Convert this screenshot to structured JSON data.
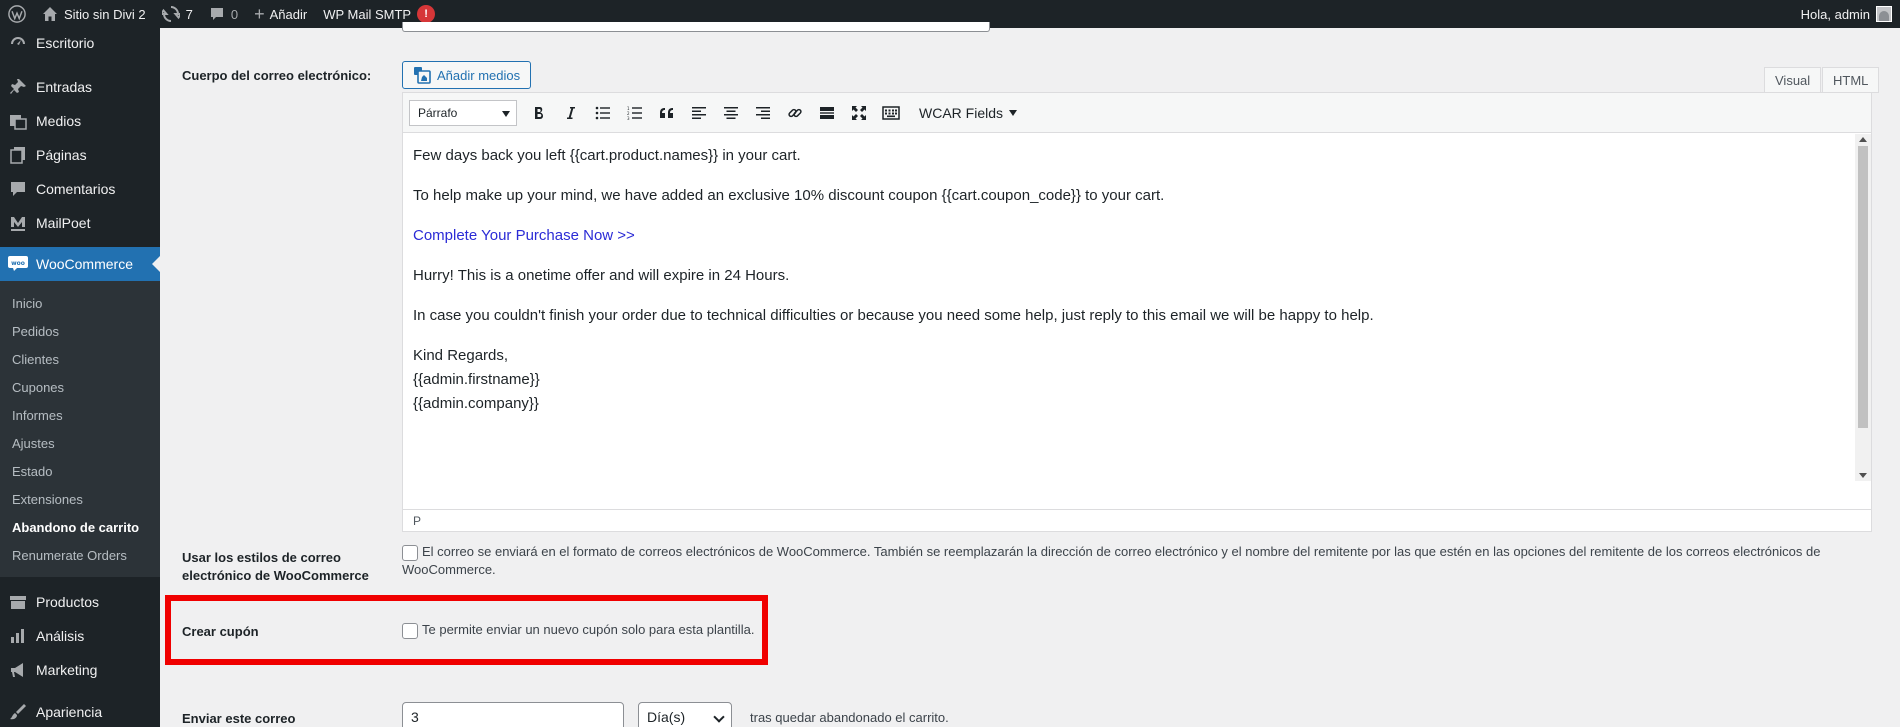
{
  "adminbar": {
    "site_name": "Sitio sin Divi 2",
    "updates_count": "7",
    "comments_count": "0",
    "add_new": "Añadir",
    "plugin_item": "WP Mail SMTP",
    "plugin_badge": "!",
    "greeting": "Hola, admin"
  },
  "sidebar": {
    "items_top": [
      "Escritorio",
      "Entradas",
      "Medios",
      "Páginas",
      "Comentarios",
      "MailPoet"
    ],
    "active": "WooCommerce",
    "submenu": [
      "Inicio",
      "Pedidos",
      "Clientes",
      "Cupones",
      "Informes",
      "Ajustes",
      "Estado",
      "Extensiones",
      "Abandono de carrito",
      "Renumerate Orders"
    ],
    "items_bottom": [
      "Productos",
      "Análisis",
      "Marketing",
      "Apariencia"
    ]
  },
  "email_body": {
    "label": "Cuerpo del correo electrónico:",
    "add_media": "Añadir medios",
    "tab_visual": "Visual",
    "tab_html": "HTML",
    "format": "Párrafo",
    "wcar_fields": "WCAR Fields",
    "lines": [
      "Few days back you left {{cart.product.names}} in your cart.",
      "To help make up your mind, we have added an exclusive 10% discount coupon {{cart.coupon_code}} to your cart.",
      "Complete Your Purchase Now >>",
      "Hurry! This is a onetime offer and will expire in 24 Hours.",
      "In case you couldn't finish your order due to technical difficulties or because you need some help, just reply to this email we will be happy to help.",
      "Kind Regards,",
      "{{admin.firstname}}",
      "{{admin.company}}"
    ],
    "status_path": "P"
  },
  "woo_styles": {
    "label": "Usar los estilos de correo electrónico de WooCommerce",
    "description": "El correo se enviará en el formato de correos electrónicos de WooCommerce. También se reemplazarán la dirección de correo electrónico y el nombre del remitente por las que estén en las opciones del remitente de los correos electrónicos de WooCommerce."
  },
  "coupon": {
    "label": "Crear cupón",
    "description": "Te permite enviar un nuevo cupón solo para esta plantilla."
  },
  "send": {
    "label": "Enviar este correo",
    "value": "3",
    "unit": "Día(s)",
    "suffix": "tras quedar abandonado el carrito."
  }
}
